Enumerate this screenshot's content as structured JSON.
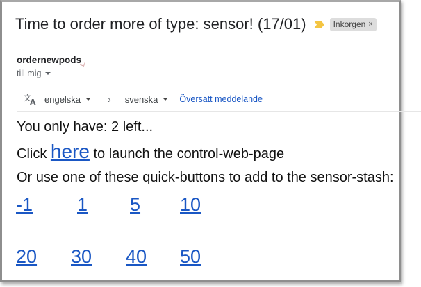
{
  "email": {
    "subject": "Time to order more of type: sensor! (17/01)",
    "label": "Inkorgen",
    "label_close": "×",
    "sender": "ordernewpods",
    "recipient": "till mig",
    "importance_color": "#f4c542"
  },
  "translate": {
    "icon": "translate-icon",
    "from_lang": "engelska",
    "arrow": "›",
    "to_lang": "svenska",
    "action": "Översätt meddelande"
  },
  "body": {
    "line1": "You only have: 2 left...",
    "click_prefix": "Click ",
    "link_here": "here",
    "click_suffix": " to launch the control-web-page",
    "line3": "Or use one of these quick-buttons to add to the sensor-stash:",
    "quick_buttons": [
      "-1",
      "1",
      "5",
      "10",
      "20",
      "30",
      "40",
      "50"
    ]
  },
  "colors": {
    "link": "#1a57c4",
    "label_bg": "#dddddd"
  }
}
